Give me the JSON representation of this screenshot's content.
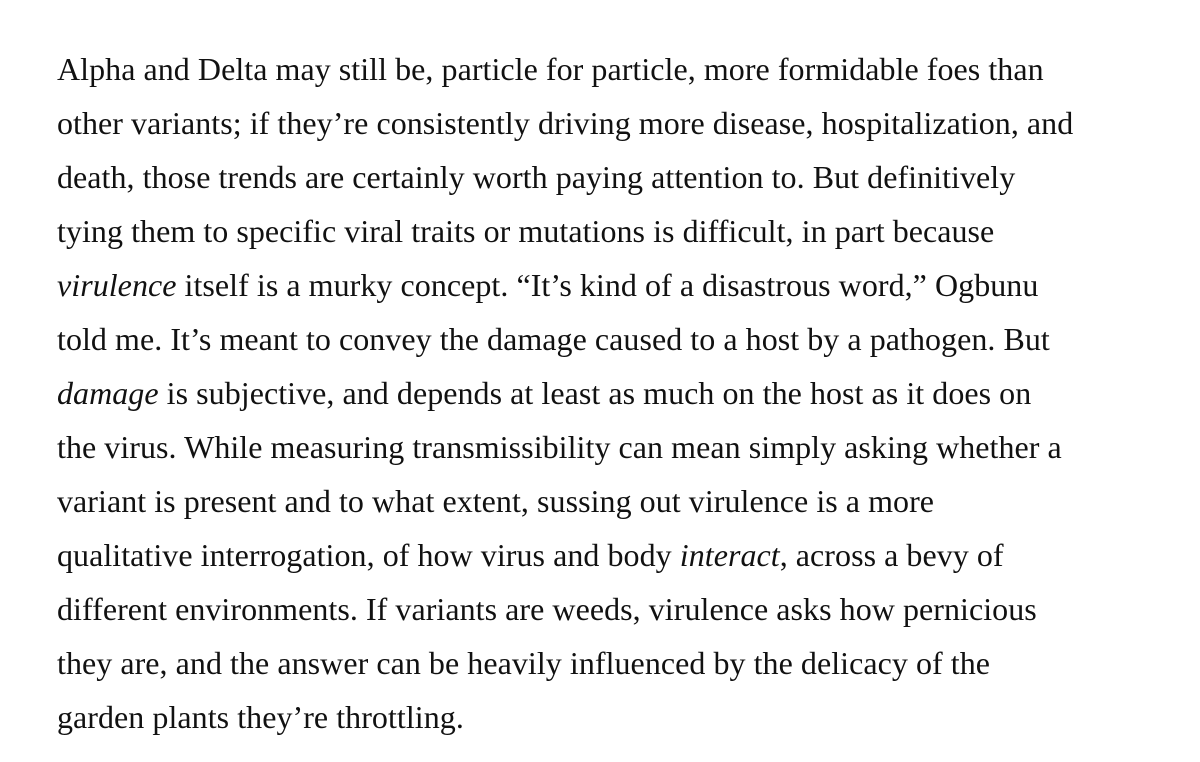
{
  "article": {
    "lines": [
      [
        {
          "text": "Alpha and Delta may still be, particle for particle, more formidable foes than"
        }
      ],
      [
        {
          "text": "other variants; if they’re consistently driving more disease, hospitalization, and"
        }
      ],
      [
        {
          "text": "death, those trends are certainly worth paying attention to. But definitively"
        }
      ],
      [
        {
          "text": "tying them to specific viral traits or mutations is difficult, in part because"
        }
      ],
      [
        {
          "text": "virulence",
          "em": true
        },
        {
          "text": " itself is a murky concept. “It’s kind of a disastrous word,” Ogbunu"
        }
      ],
      [
        {
          "text": "told me. It’s meant to convey the damage caused to a host by a pathogen. But"
        }
      ],
      [
        {
          "text": "damage",
          "em": true
        },
        {
          "text": " is subjective, and depends at least as much on the host as it does on"
        }
      ],
      [
        {
          "text": "the virus. While measuring transmissibility can mean simply asking whether a"
        }
      ],
      [
        {
          "text": "variant is present and to what extent, sussing out virulence is a more"
        }
      ],
      [
        {
          "text": "qualitative interrogation, of how virus and body "
        },
        {
          "text": "interact",
          "em": true
        },
        {
          "text": ", across a bevy of"
        }
      ],
      [
        {
          "text": "different environments. If variants are weeds, virulence asks how pernicious"
        }
      ],
      [
        {
          "text": "they are, and the answer can be heavily influenced by the delicacy of the"
        }
      ],
      [
        {
          "text": "garden plants they’re throttling."
        }
      ]
    ]
  }
}
